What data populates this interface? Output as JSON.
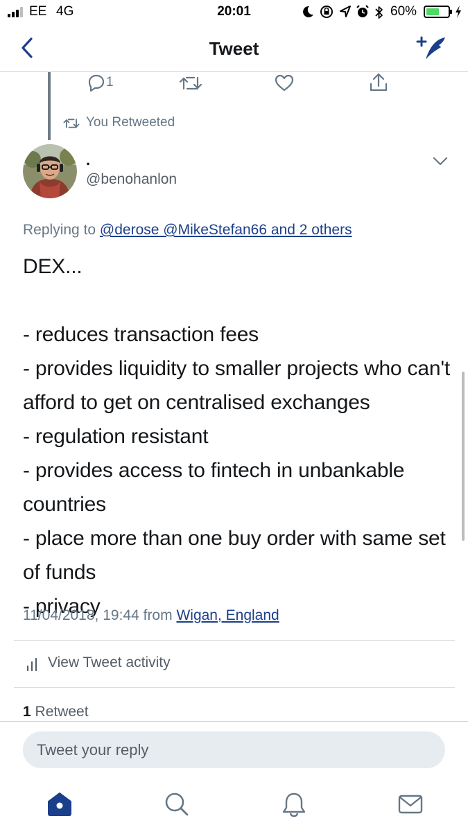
{
  "status_bar": {
    "carrier": "EE",
    "network": "4G",
    "time": "20:01",
    "battery_percent_label": "60%",
    "battery_level": 0.6,
    "battery_color": "#4cd964"
  },
  "nav": {
    "title": "Tweet",
    "back_icon": "chevron-left-icon",
    "compose_icon": "compose-tweet-icon",
    "accent_color": "#1b3f8b"
  },
  "previous_tweet_actions": {
    "reply_count": "1",
    "icons": [
      "reply-icon",
      "retweet-icon",
      "like-icon",
      "share-icon"
    ]
  },
  "retweet_note": "You Retweeted",
  "tweet": {
    "display_name": ".",
    "handle": "@benohanlon",
    "replying_prefix": "Replying to",
    "replying_to": "@derose @MikeStefan66 and 2 others",
    "text": "DEX...\n\n- reduces transaction fees\n- provides liquidity to smaller projects who can't afford to get on centralised exchanges\n- regulation resistant\n- provides access to fintech in unbankable countries\n- place more than one buy order with same set of funds\n- privacy",
    "timestamp": "11/04/2018, 19:44",
    "from_label": "from",
    "location": "Wigan, England"
  },
  "activity": {
    "label": "View Tweet activity"
  },
  "stats": {
    "retweet_count": "1",
    "retweet_label": "Retweet"
  },
  "reply_composer": {
    "placeholder": "Tweet your reply"
  },
  "tab_bar": {
    "tabs": [
      "home-icon",
      "search-icon",
      "notifications-icon",
      "messages-icon"
    ],
    "active": "home-icon"
  }
}
